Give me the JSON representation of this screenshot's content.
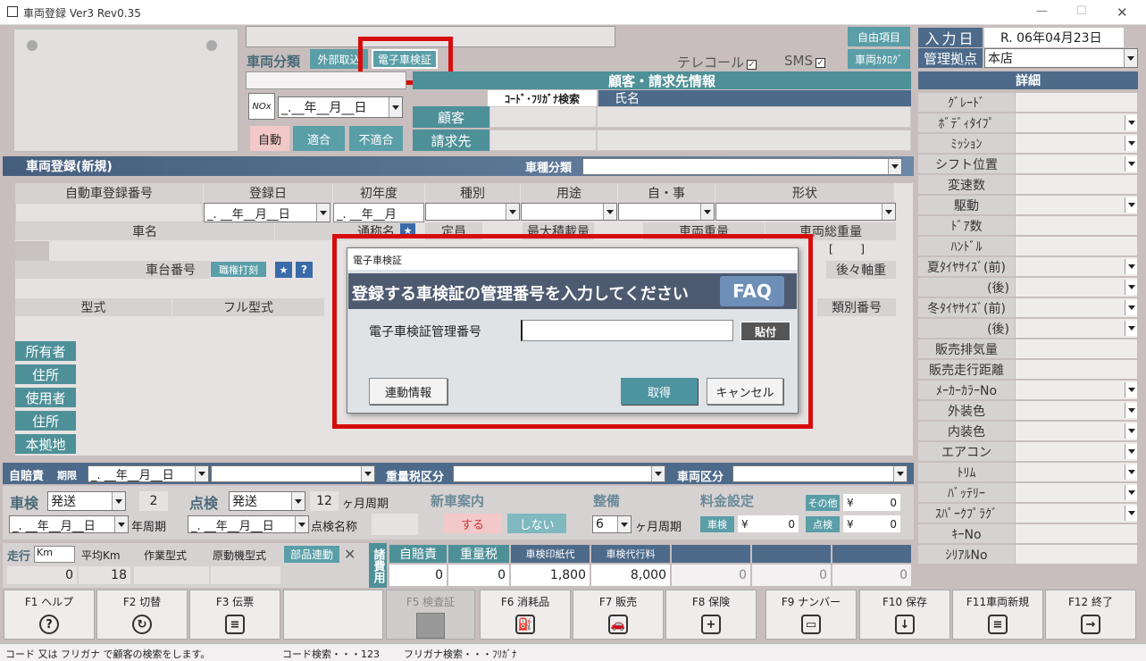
{
  "window": {
    "title": "車両登録 Ver3 Rev0.35",
    "min": "—",
    "max": "☐",
    "close": "✕"
  },
  "top": {
    "vehicle_class": "車両分類",
    "external": "外部取込",
    "eshaken": "電子車検証",
    "telecall": "テレコール",
    "sms": "SMS",
    "check": "✓",
    "free_item": "自由項目",
    "catalog": "車両ｶﾀﾛｸﾞ",
    "date_ph": "_.__年__月__日",
    "auto": "自動",
    "fit": "適合",
    "nofit": "不適合",
    "nox": "NOx"
  },
  "customer": {
    "header": "顧客・請求先情報",
    "code_search": "ｺｰﾄﾞ･ﾌﾘｶﾞﾅ検索",
    "name": "氏名",
    "customer": "顧客",
    "billing": "請求先"
  },
  "input_date": {
    "label": "入力日",
    "value": "R. 06年04月23日"
  },
  "base": {
    "label": "管理拠点",
    "value": "本店"
  },
  "detail": {
    "header": "詳細",
    "rows": [
      "ｸﾞﾚｰﾄﾞ",
      "ﾎﾞﾃﾞｨﾀｲﾌﾟ",
      "ﾐｯｼｮﾝ",
      "シフト位置",
      "変速数",
      "駆動",
      "ﾄﾞｱ数",
      "ﾊﾝﾄﾞﾙ",
      "夏ﾀｲﾔｻｲｽﾞ(前)",
      "(後)",
      "冬ﾀｲﾔｻｲｽﾞ(前)",
      "(後)",
      "販売排気量",
      "販売走行距離",
      "ﾒｰｶｰｶﾗｰNo",
      "外装色",
      "内装色",
      "エアコン",
      "ﾄﾘﾑ",
      "ﾊﾞｯﾃﾘｰ",
      "ｽﾊﾟｰｸﾌﾟﾗｸﾞ",
      "ｷｰNo",
      "ｼﾘｱﾙNo"
    ]
  },
  "reg": {
    "header": "車両登録(新規)",
    "type_class": "車種分類",
    "plate": "自動車登録番号",
    "reg_date": "登録日",
    "first_year": "初年度",
    "kind": "種別",
    "use": "用途",
    "self": "自・事",
    "shape": "形状",
    "date1": "_. __年__月__日",
    "date2": "_. __年__月",
    "car_name": "車名",
    "common_name": "通称名",
    "capacity": "定員",
    "load": "最大積載量",
    "vweight": "車両重量",
    "gweight": "車両総重量",
    "bracket": "[        ]",
    "chassis": "車台番号",
    "stamp": "職権打刻",
    "q": "?",
    "star": "★",
    "axle": "後々軸重",
    "model": "型式",
    "full_model": "フル型式",
    "class_no": "類別番号",
    "owner": "所有者",
    "address": "住所",
    "user": "使用者",
    "home": "本拠地"
  },
  "insurance": {
    "label": "自賠責",
    "period": "期限",
    "date": "_. __年__月__日",
    "weight_tax": "重量税区分",
    "vehicle_div": "車両区分"
  },
  "inspect": {
    "shaken": "車検",
    "send": "発送",
    "cycle": "2",
    "year_cycle": "年周期",
    "tenken": "点検",
    "send2": "発送",
    "cycle2": "12",
    "month_cycle": "ヶ月周期",
    "check_name": "点検名称",
    "new_car": "新車案内",
    "yes": "する",
    "no": "しない",
    "maint": "整備",
    "maint_v": "6",
    "fee": "料金設定",
    "other": "その他",
    "yen": "¥",
    "zero": "0",
    "shaken_btn": "車検",
    "tenken_btn": "点検"
  },
  "run": {
    "run": "走行",
    "km": "Km",
    "avg": "平均Km",
    "work": "作業型式",
    "engine": "原動機型式",
    "parts": "部品連動",
    "x": "✕",
    "v_run": "0",
    "v_avg": "18"
  },
  "bill": {
    "title": "諸費用",
    "cols": [
      "自賠責",
      "重量税",
      "車検印紙代",
      "車検代行料",
      "",
      "",
      ""
    ],
    "vals": [
      "0",
      "0",
      "1,800",
      "8,000",
      "0",
      "0",
      "0"
    ]
  },
  "fkeys": [
    {
      "k": "F1 ヘルプ",
      "i": "?"
    },
    {
      "k": "F2 切替",
      "i": "↻"
    },
    {
      "k": "F3 伝票",
      "i": "≡"
    },
    {
      "k": "",
      "i": ""
    },
    {
      "k": "F5 検査証",
      "i": ""
    },
    {
      "k": "F6 消耗品",
      "i": "⛽"
    },
    {
      "k": "F7 販売",
      "i": "🚗"
    },
    {
      "k": "F8 保険",
      "i": "+"
    },
    {
      "k": "F9 ナンバー",
      "i": "▭"
    },
    {
      "k": "F10 保存",
      "i": "↓"
    },
    {
      "k": "F11車両新規",
      "i": "≡"
    },
    {
      "k": "F12 終了",
      "i": "→"
    }
  ],
  "status": {
    "hint": "コード 又は フリガナ で顧客の検索をします。",
    "code": "コード検索・・・123",
    "kana": "フリガナ検索・・・ﾌﾘｶﾞﾅ"
  },
  "dialog": {
    "title": "電子車検証",
    "message": "登録する車検証の管理番号を入力してください",
    "faq": "FAQ",
    "field_label": "電子車検証管理番号",
    "paste": "貼付",
    "link": "連動情報",
    "get": "取得",
    "cancel": "キャンセル",
    "value": ""
  }
}
